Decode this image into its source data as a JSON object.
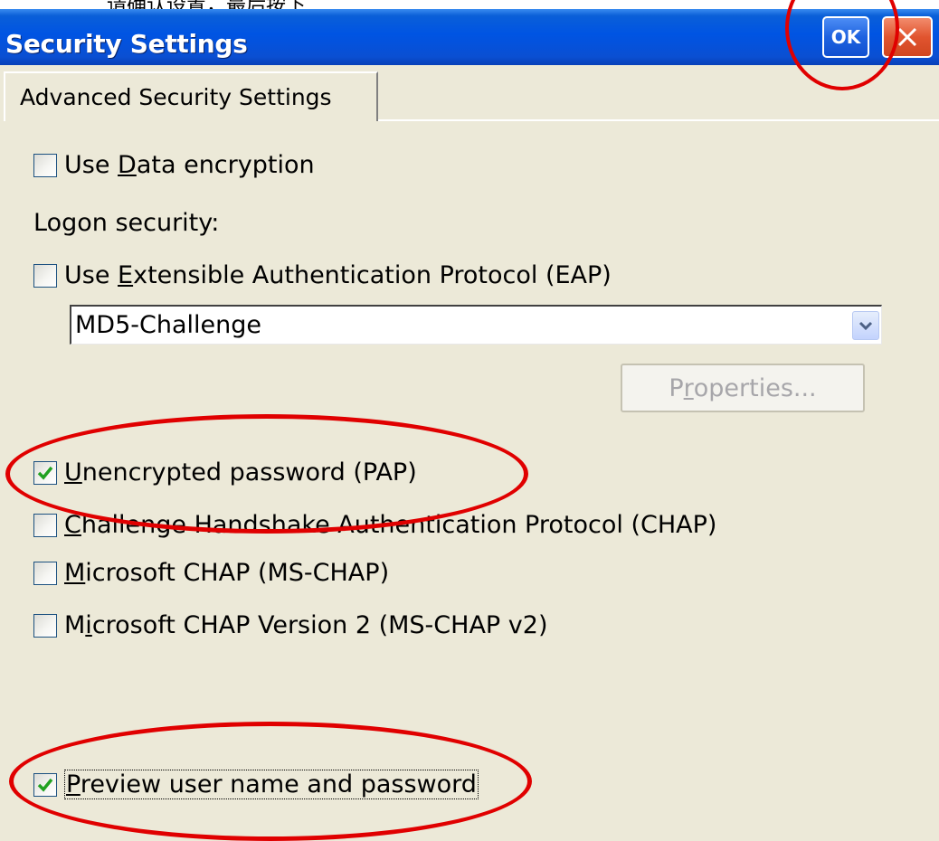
{
  "top_note": "请确认设置，最后按下",
  "window": {
    "title": "Security Settings",
    "ok_label": "OK"
  },
  "tab": {
    "label": "Advanced Security Settings"
  },
  "options": {
    "data_encryption": {
      "pre": "Use ",
      "key": "D",
      "post": "ata encryption",
      "checked": false
    },
    "logon_security_label": "Logon security:",
    "eap": {
      "pre": "Use ",
      "key": "E",
      "post": "xtensible Authentication Protocol (EAP)",
      "checked": false
    },
    "eap_method": {
      "value": "MD5-Challenge"
    },
    "properties_button": {
      "pre": "P",
      "key": "r",
      "post": "operties..."
    },
    "pap": {
      "pre": "",
      "key": "U",
      "post": "nencrypted password (PAP)",
      "checked": true
    },
    "chap": {
      "pre": "",
      "key": "C",
      "post": "hallenge Handshake Authentication Protocol (CHAP)",
      "checked": false
    },
    "ms_chap": {
      "pre": "",
      "key": "M",
      "post": "icrosoft CHAP (MS-CHAP)",
      "checked": false
    },
    "ms_chap_v2": {
      "pre": "M",
      "key": "i",
      "post": "crosoft CHAP Version 2 (MS-CHAP v2)",
      "checked": false
    },
    "preview": {
      "pre": "",
      "key": "P",
      "post": "review user name and password",
      "checked": true
    }
  },
  "colors": {
    "annotation": "#E00000",
    "title_bar": "#0054E3",
    "dialog_bg": "#ECE9D8",
    "check_mark": "#21A121"
  },
  "icons": {
    "check": "check-icon",
    "close": "close-x-icon",
    "dropdown": "chevron-down-icon"
  }
}
